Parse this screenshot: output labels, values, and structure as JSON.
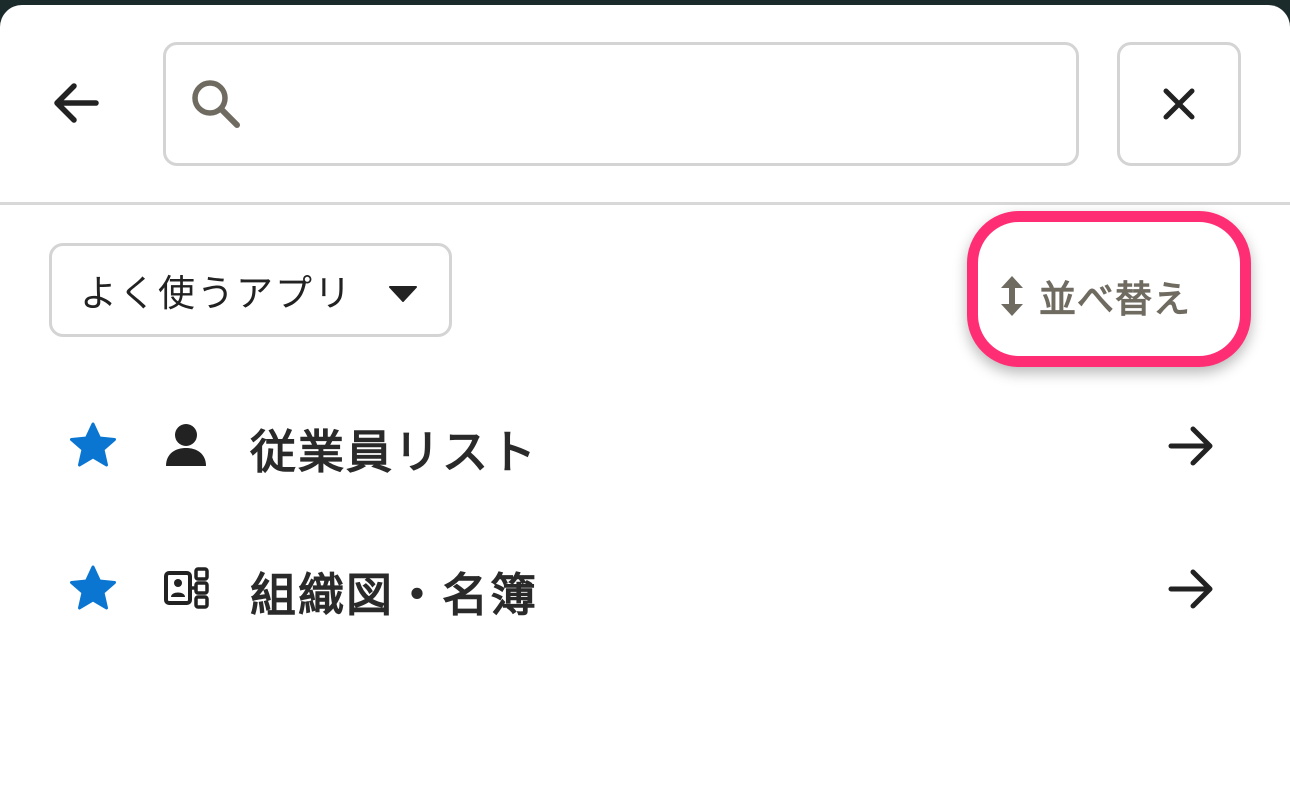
{
  "header": {
    "back_icon": "arrow-left-icon",
    "search": {
      "icon": "search-icon",
      "value": "",
      "placeholder": ""
    },
    "close_icon": "close-icon"
  },
  "filter": {
    "selected": "よく使うアプリ",
    "icon": "caret-down-icon"
  },
  "sort": {
    "label": "並べ替え",
    "icon": "sort-vertical-icon",
    "highlight_color": "#ff2e74"
  },
  "apps": [
    {
      "name": "従業員リスト",
      "icon": "person-icon",
      "favorite": true,
      "star_color": "#0b76d1"
    },
    {
      "name": "組織図・名簿",
      "icon": "org-chart-icon",
      "favorite": true,
      "star_color": "#0b76d1"
    }
  ]
}
